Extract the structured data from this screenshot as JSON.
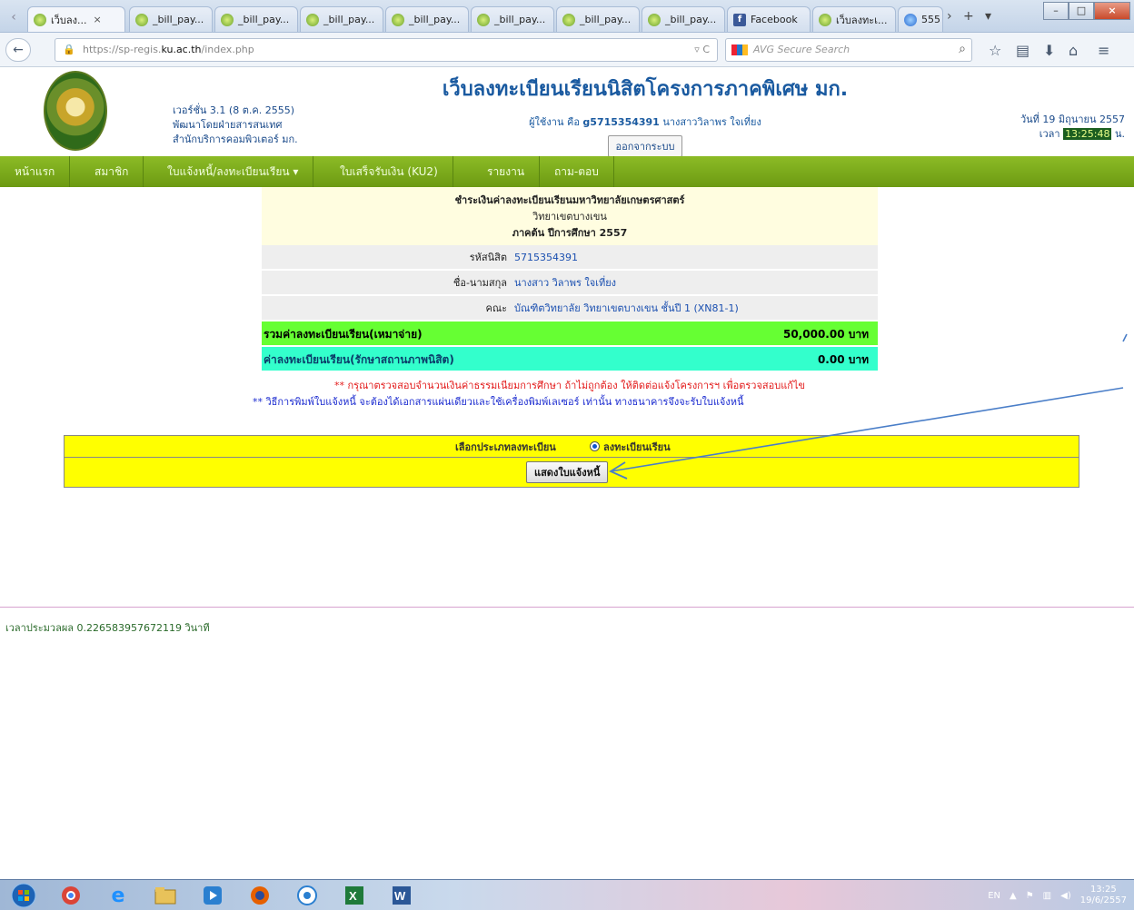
{
  "browser": {
    "tabs": [
      {
        "label": "เว็บลง...",
        "active": true
      },
      {
        "label": "_bill_pay..."
      },
      {
        "label": "_bill_pay..."
      },
      {
        "label": "_bill_pay..."
      },
      {
        "label": "_bill_pay..."
      },
      {
        "label": "_bill_pay..."
      },
      {
        "label": "_bill_pay..."
      },
      {
        "label": "_bill_pay..."
      },
      {
        "label": "Facebook"
      },
      {
        "label": "เว็บลงทะเ..."
      },
      {
        "label": "555"
      }
    ],
    "url_prefix": "https://sp-regis.",
    "url_domain": "ku.ac.th",
    "url_suffix": "/index.php",
    "search_placeholder": "AVG Secure Search"
  },
  "header": {
    "version": "เวอร์ชั่น 3.1 (8 ต.ค. 2555)",
    "developer": "พัฒนาโดยฝ่ายสารสนเทศ",
    "office": "สำนักบริการคอมพิวเตอร์ มก.",
    "site_title": "เว็บลงทะเบียนเรียนนิสิตโครงการภาคพิเศษ มก.",
    "user_prefix": "ผู้ใช้งาน คือ",
    "user_id": "g5715354391",
    "user_name": "นางสาววิลาพร ใจเที่ยง",
    "logout_label": "ออกจากระบบ",
    "date_text": "วันที่ 19 มิถุนายน 2557",
    "time_prefix": "เวลา",
    "time_value": "13:25:48",
    "time_suffix": "น."
  },
  "menu": [
    "หน้าแรก",
    "สมาชิก",
    "ใบแจ้งหนี้/ลงทะเบียนเรียน ▾",
    "ใบเสร็จรับเงิน (KU2)",
    "รายงาน",
    "ถาม-ตอบ"
  ],
  "payment": {
    "heading1": "ชำระเงินค่าลงทะเบียนเรียนมหาวิทยาลัยเกษตรศาสตร์",
    "heading2": "วิทยาเขตบางเขน",
    "heading3": "ภาคต้น ปีการศึกษา 2557",
    "rows": [
      {
        "label": "รหัสนิสิต",
        "value": "5715354391"
      },
      {
        "label": "ชื่อ-นามสกุล",
        "value": "นางสาว วิลาพร ใจเที่ยง"
      },
      {
        "label": "คณะ",
        "value": "บัณฑิตวิทยาลัย วิทยาเขตบางเขน ชั้นปี 1 (XN81-1)"
      }
    ],
    "total_label": "รวมค่าลงทะเบียนเรียน(เหมาจ่าย)",
    "total_value": "50,000.00 บาท",
    "status_label": "ค่าลงทะเบียนเรียน(รักษาสถานภาพนิสิต)",
    "status_value": "0.00 บาท",
    "note1": "** กรุณาตรวจสอบจำนวนเงินค่าธรรมเนียมการศึกษา ถ้าไม่ถูกต้อง ให้ติดต่อแจ้งโครงการฯ เพื่อตรวจสอบแก้ไข",
    "note2": "** วิธีการพิมพ์ใบแจ้งหนี้ จะต้องได้เอกสารแผ่นเดียวและใช้เครื่องพิมพ์เลเซอร์ เท่านั้น ทางธนาคารจึงจะรับใบแจ้งหนี้"
  },
  "selection": {
    "label": "เลือกประเภทลงทะเบียน",
    "option": "ลงทะเบียนเรียน",
    "button": "แสดงใบแจ้งหนี้"
  },
  "footer": {
    "load_time": "เวลาประมวลผล 0.226583957672119 วินาที"
  },
  "taskbar": {
    "lang": "EN",
    "time": "13:25",
    "date": "19/6/2557"
  }
}
